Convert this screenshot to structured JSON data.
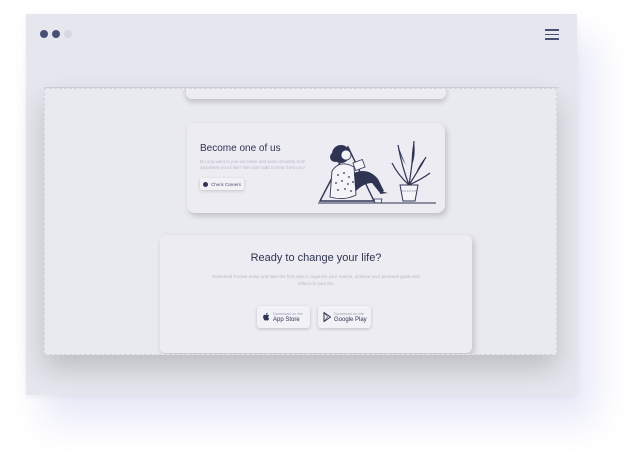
{
  "window": {
    "controls": [
      "close-dot",
      "minimize-dot",
      "maximize-dot"
    ],
    "menu_icon": "hamburger-menu-icon"
  },
  "join_section": {
    "title": "Become one of us",
    "description": "Do you want to join our team and work remotely from anywhere you'd like? We can't wait to hear from you!",
    "button_label": "Check Careers",
    "button_icon": "circle-icon"
  },
  "ready_section": {
    "title": "Ready to change your life?",
    "description": "Download Pocket today and take the first step to organize your routine, achieve your personal goals and reflect on your life.",
    "app_store": {
      "small": "Download on the",
      "big": "App Store",
      "icon": "apple-icon"
    },
    "google_play": {
      "small": "Download on the",
      "big": "Google Play",
      "icon": "play-icon"
    }
  },
  "colors": {
    "accent": "#2f3452",
    "window_bg": "#e6e7ee",
    "card_bg": "#ececf2",
    "muted_text": "#b7b9c9"
  }
}
